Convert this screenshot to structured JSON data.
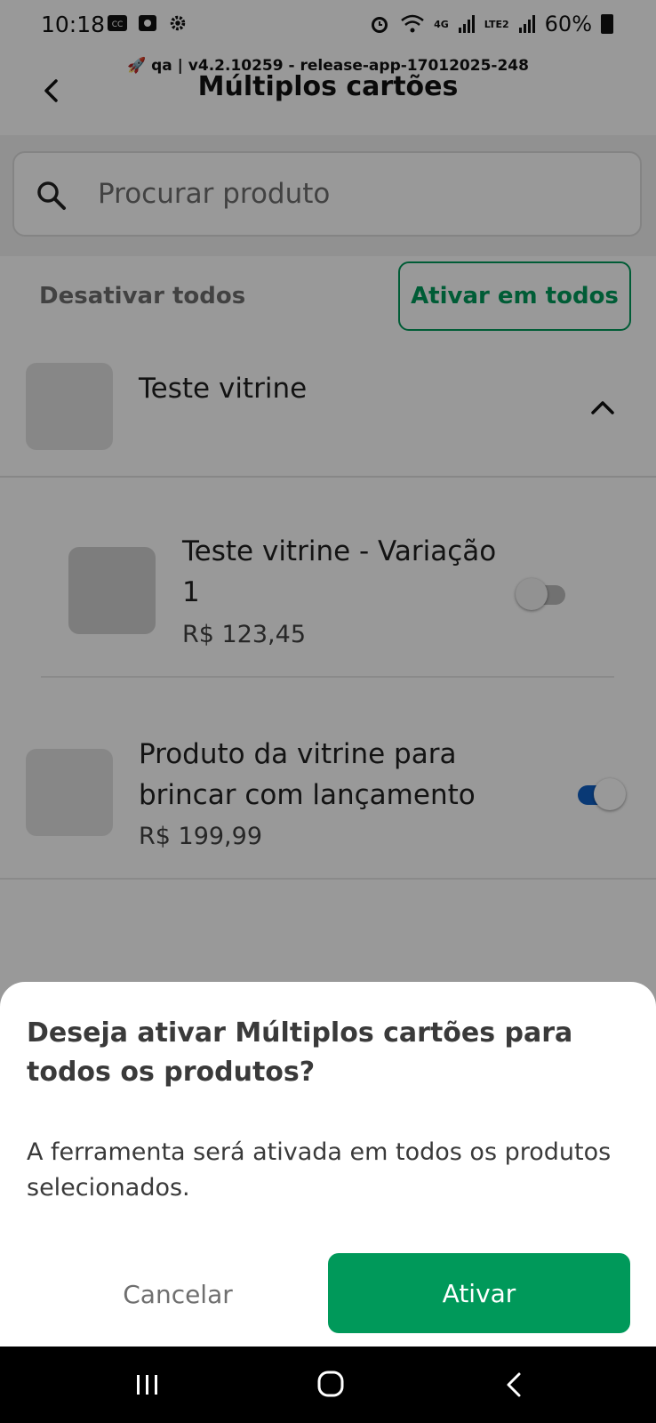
{
  "status_bar": {
    "time": "10:18",
    "network": "4G",
    "lte": "LTE2",
    "battery": "60%"
  },
  "app_bar": {
    "env_tag": "🚀 qa | v4.2.10259 - release-app-17012025-248",
    "title": "Múltiplos cartões"
  },
  "search": {
    "placeholder": "Procurar produto",
    "value": ""
  },
  "actions": {
    "disable_all": "Desativar todos",
    "enable_all": "Ativar em todos"
  },
  "products": [
    {
      "name": "Teste vitrine",
      "expanded": true,
      "variations": [
        {
          "name_line1": "Teste vitrine - Variação",
          "name_line2": "1",
          "price": "R$ 123,45",
          "enabled": false
        }
      ]
    },
    {
      "name_line1": "Produto da vitrine para",
      "name_line2": "brincar com lançamento",
      "price": "R$ 199,99",
      "enabled": true
    }
  ],
  "dialog": {
    "title": "Deseja ativar Múltiplos cartões para todos os produtos?",
    "body": "A ferramenta será ativada em todos os produtos selecionados.",
    "cancel_label": "Cancelar",
    "confirm_label": "Ativar"
  },
  "colors": {
    "brand_green": "#00995a",
    "toggle_on": "#0f5fc4",
    "scrim": "rgba(0,0,0,0.40)"
  }
}
